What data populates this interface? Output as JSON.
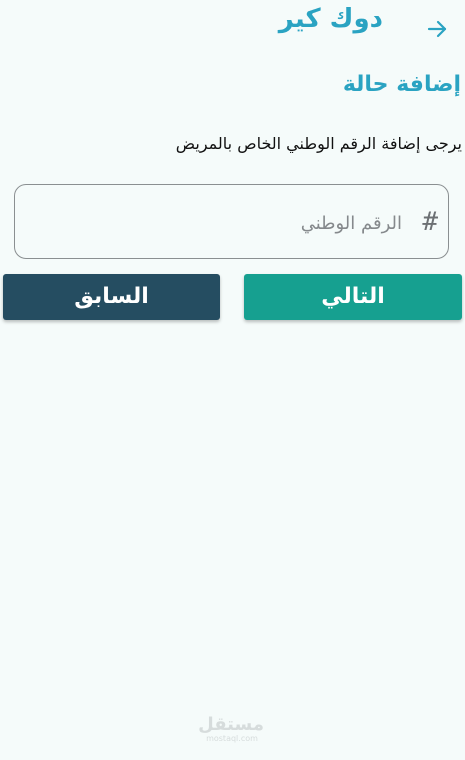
{
  "header": {
    "app_title": "دوك كير",
    "back_icon": "arrow-right-icon"
  },
  "section": {
    "title": "إضافة حالة",
    "instruction": "يرجى إضافة الرقم الوطني الخاص بالمريض"
  },
  "form": {
    "national_id": {
      "placeholder": "الرقم الوطني",
      "value": "",
      "icon": "hash-icon",
      "icon_glyph": "#"
    }
  },
  "buttons": {
    "next_label": "التالي",
    "prev_label": "السابق"
  },
  "watermark": {
    "main": "مستقل",
    "sub": "mostaql.com"
  },
  "colors": {
    "background": "#f5fbfa",
    "title_color": "#2aa3c2",
    "next_button": "#16a090",
    "prev_button": "#254d61"
  }
}
